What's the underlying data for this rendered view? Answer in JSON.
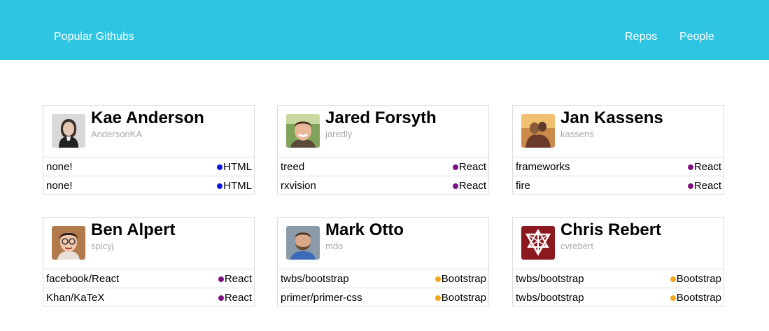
{
  "header": {
    "brand": "Popular Githubs",
    "nav": {
      "repos": "Repos",
      "people": "People"
    }
  },
  "colors": {
    "header_bg": "#2ec5e3",
    "html": "#0b18e6",
    "react": "#7d1180",
    "bootstrap": "#f3a51c"
  },
  "users": [
    {
      "name": "Kae Anderson",
      "login": "AndersonKA",
      "avatar_icon": "woman-portrait-avatar",
      "repos": [
        {
          "name": "none!",
          "language": "HTML",
          "color": "#0b18e6"
        },
        {
          "name": "none!",
          "language": "HTML",
          "color": "#0b18e6"
        }
      ]
    },
    {
      "name": "Jared Forsyth",
      "login": "jaredly",
      "avatar_icon": "smiling-man-avatar",
      "repos": [
        {
          "name": "treed",
          "language": "React",
          "color": "#7d1180"
        },
        {
          "name": "rxvision",
          "language": "React",
          "color": "#7d1180"
        }
      ]
    },
    {
      "name": "Jan Kassens",
      "login": "kassens",
      "avatar_icon": "couple-photo-avatar",
      "repos": [
        {
          "name": "frameworks",
          "language": "React",
          "color": "#7d1180"
        },
        {
          "name": "fire",
          "language": "React",
          "color": "#7d1180"
        }
      ]
    },
    {
      "name": "Ben Alpert",
      "login": "spicyj",
      "avatar_icon": "man-glasses-avatar",
      "repos": [
        {
          "name": "facebook/React",
          "language": "React",
          "color": "#7d1180"
        },
        {
          "name": "Khan/KaTeX",
          "language": "React",
          "color": "#7d1180"
        }
      ]
    },
    {
      "name": "Mark Otto",
      "login": "mdo",
      "avatar_icon": "bearded-man-avatar",
      "repos": [
        {
          "name": "twbs/bootstrap",
          "language": "Bootstrap",
          "color": "#f3a51c"
        },
        {
          "name": "primer/primer-css",
          "language": "Bootstrap",
          "color": "#f3a51c"
        }
      ]
    },
    {
      "name": "Chris Rebert",
      "login": "cvrebert",
      "avatar_icon": "red-triangle-emblem-avatar",
      "repos": [
        {
          "name": "twbs/bootstrap",
          "language": "Bootstrap",
          "color": "#f3a51c"
        },
        {
          "name": "twbs/bootstrap",
          "language": "Bootstrap",
          "color": "#f3a51c"
        }
      ]
    }
  ]
}
